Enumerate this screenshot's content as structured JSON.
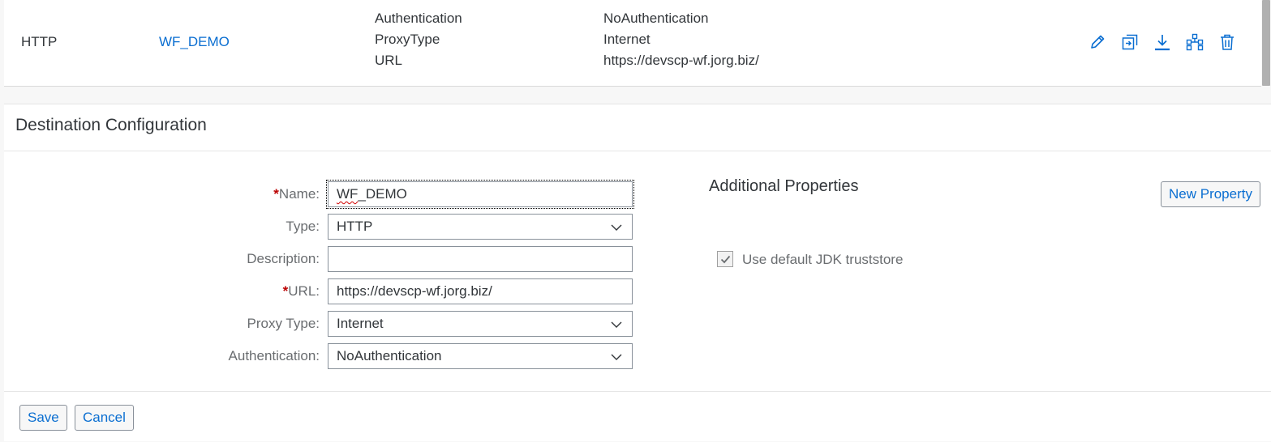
{
  "destination_row": {
    "type": "HTTP",
    "name": "WF_DEMO",
    "property_keys": [
      "Authentication",
      "ProxyType",
      "URL"
    ],
    "property_values": [
      "NoAuthentication",
      "Internet",
      "https://devscp-wf.jorg.biz/"
    ],
    "action_icons": [
      "edit-icon",
      "clone-icon",
      "download-icon",
      "connection-check-icon",
      "delete-icon"
    ]
  },
  "panel": {
    "title": "Destination Configuration"
  },
  "form": {
    "name_label": "Name:",
    "name_value": "WF_DEMO",
    "name_value_part1": "WF",
    "name_value_part2": "_DEMO",
    "type_label": "Type:",
    "type_value": "HTTP",
    "description_label": "Description:",
    "description_value": "",
    "url_label": "URL:",
    "url_value": "https://devscp-wf.jorg.biz/",
    "proxy_type_label": "Proxy Type:",
    "proxy_type_value": "Internet",
    "authentication_label": "Authentication:",
    "authentication_value": "NoAuthentication",
    "required_marker": "*"
  },
  "additional_properties": {
    "title": "Additional Properties",
    "new_property_label": "New Property",
    "use_default_jdk_truststore_label": "Use default JDK truststore",
    "use_default_jdk_truststore_checked": true
  },
  "footer": {
    "save_label": "Save",
    "cancel_label": "Cancel"
  },
  "colors": {
    "link": "#0a6ed1",
    "required": "#bb0000",
    "label": "#6a6d70",
    "text": "#32363a"
  }
}
